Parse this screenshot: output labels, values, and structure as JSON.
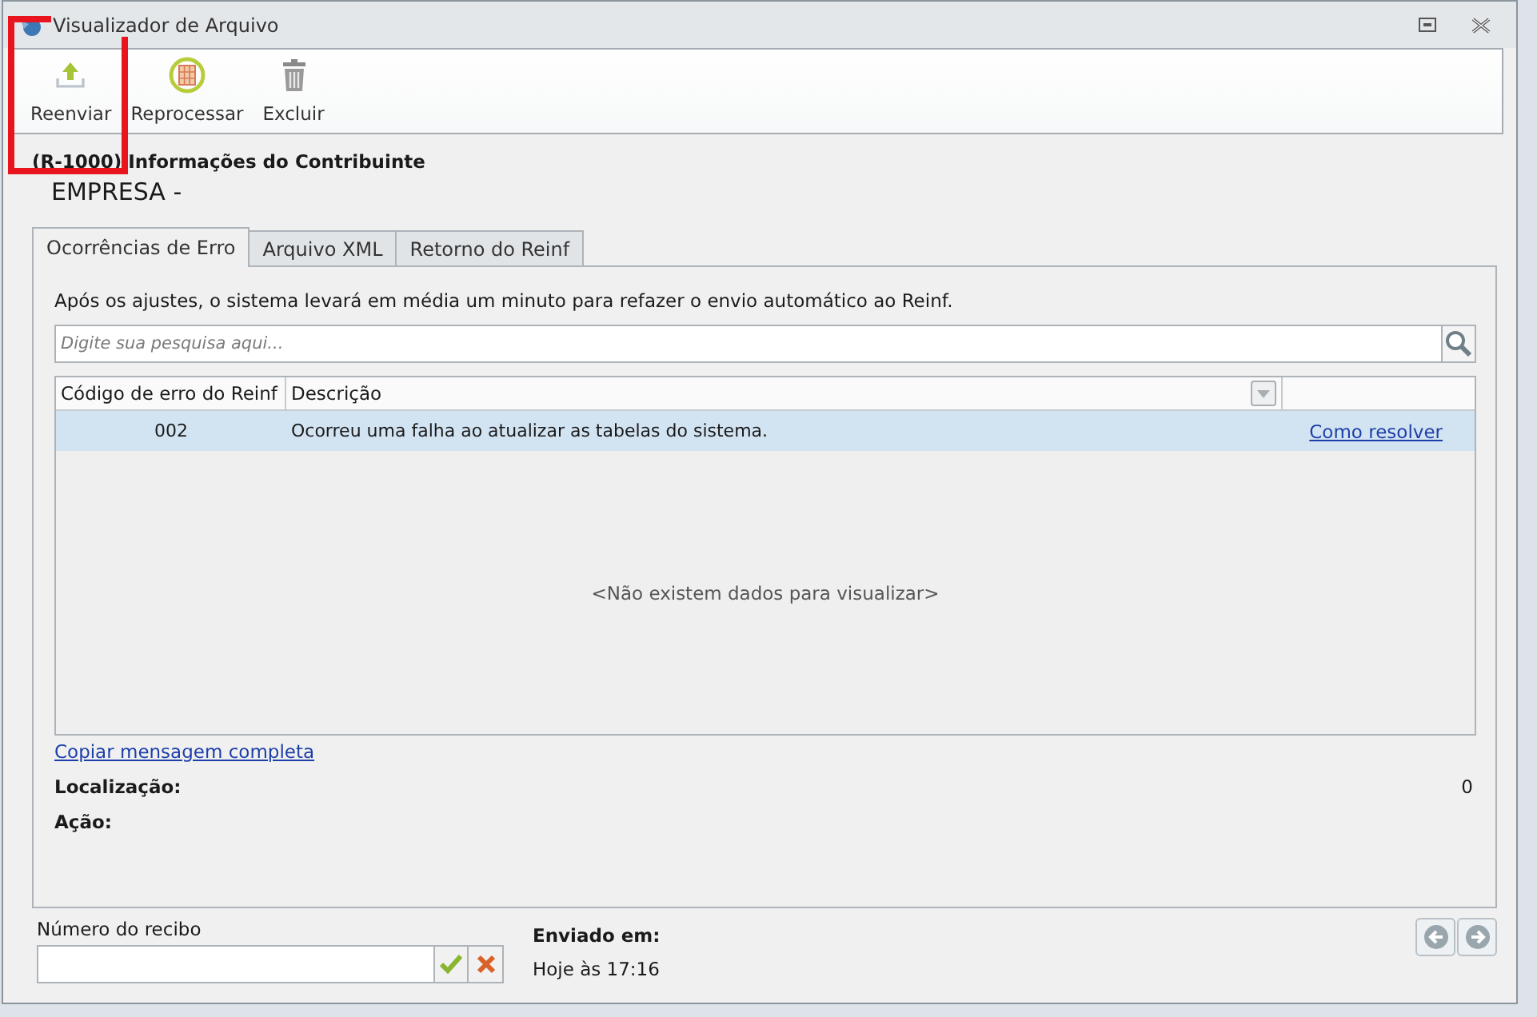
{
  "window": {
    "title": "Visualizador de Arquivo"
  },
  "toolbar": [
    {
      "kind": "upload",
      "label": "Reenviar"
    },
    {
      "kind": "reprocess",
      "label": "Reprocessar"
    },
    {
      "kind": "delete",
      "label": "Excluir"
    }
  ],
  "annotation": {
    "kind": "rectangle",
    "color": "#e8141e"
  },
  "header": {
    "code": "(R-1000)",
    "title": "Informações do Contribuinte",
    "company": "EMPRESA -"
  },
  "tabs": [
    {
      "label": "Ocorrências de Erro",
      "selected": true
    },
    {
      "label": "Arquivo XML",
      "selected": false
    },
    {
      "label": "Retorno do Reinf",
      "selected": false
    }
  ],
  "note": "Após os ajustes, o sistema levará em média um minuto para refazer o envio automático ao Reinf.",
  "search": {
    "placeholder": "Digite sua pesquisa aqui..."
  },
  "table": {
    "columns": [
      "Código de erro do Reinf",
      "Descrição"
    ],
    "rows": [
      {
        "code": "002",
        "description": "Ocorreu uma falha ao atualizar as tabelas do sistema.",
        "link": "Como resolver",
        "selected": true
      }
    ],
    "empty_message": "<Não existem dados para visualizar>"
  },
  "copy_link": "Copiar mensagem completa",
  "details": [
    {
      "label": "Localização:",
      "value": "0"
    },
    {
      "label": "Ação:"
    }
  ],
  "receipt": {
    "label": "Número do recibo"
  },
  "sent": {
    "label": "Enviado em:",
    "value": "Hoje às 17:16"
  }
}
